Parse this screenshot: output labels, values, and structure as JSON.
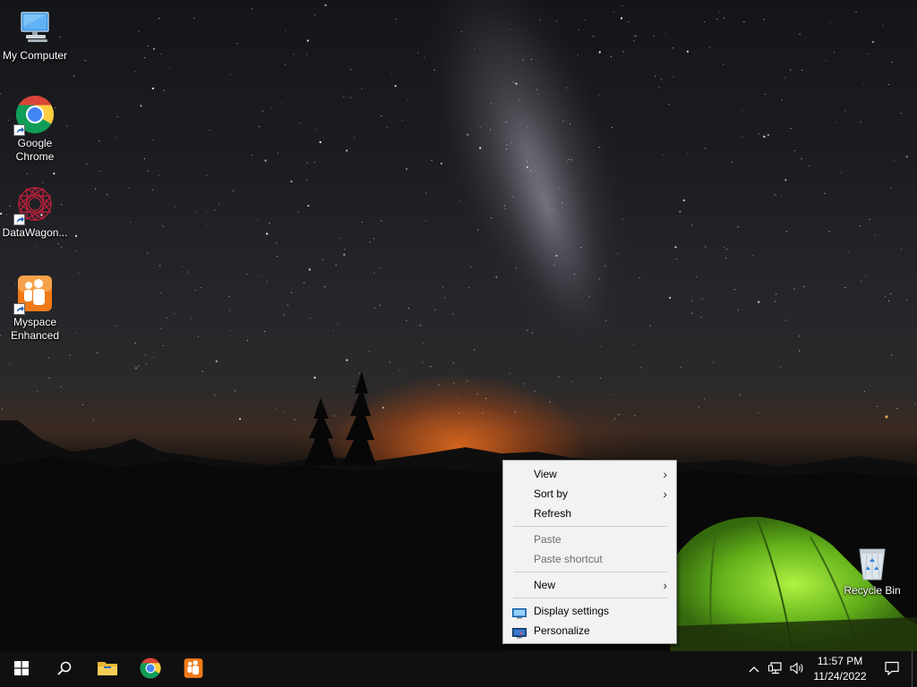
{
  "desktop": {
    "icons": [
      {
        "label": "My Computer",
        "icon": "my-computer-icon"
      },
      {
        "label": "Google Chrome",
        "icon": "chrome-icon"
      },
      {
        "label": "DataWagon...",
        "icon": "datawagon-icon"
      },
      {
        "label": "Myspace Enhanced",
        "icon": "myspace-enhanced-icon"
      },
      {
        "label": "Recycle Bin",
        "icon": "recycle-bin-icon"
      }
    ]
  },
  "context_menu": {
    "items": [
      {
        "label": "View",
        "submenu": true,
        "enabled": true
      },
      {
        "label": "Sort by",
        "submenu": true,
        "enabled": true
      },
      {
        "label": "Refresh",
        "submenu": false,
        "enabled": true
      },
      {
        "label": "Paste",
        "submenu": false,
        "enabled": false
      },
      {
        "label": "Paste shortcut",
        "submenu": false,
        "enabled": false
      },
      {
        "label": "New",
        "submenu": true,
        "enabled": true
      },
      {
        "label": "Display settings",
        "submenu": false,
        "enabled": true,
        "icon": "display-settings-icon"
      },
      {
        "label": "Personalize",
        "submenu": false,
        "enabled": true,
        "icon": "personalize-icon"
      }
    ],
    "submenu_arrow": "›"
  },
  "taskbar": {
    "pinned": [
      "start-icon",
      "search-icon",
      "file-explorer-icon",
      "chrome-icon",
      "myspace-enhanced-icon"
    ],
    "tray": {
      "time": "11:57 PM",
      "date": "11/24/2022",
      "icons": [
        "chevron-up-icon",
        "network-icon",
        "volume-icon",
        "action-center-icon"
      ]
    }
  },
  "colors": {
    "accent": "#76b9ed",
    "taskbar": "#101010",
    "menu_bg": "#f2f2f2",
    "tent": "#7fd12a"
  }
}
